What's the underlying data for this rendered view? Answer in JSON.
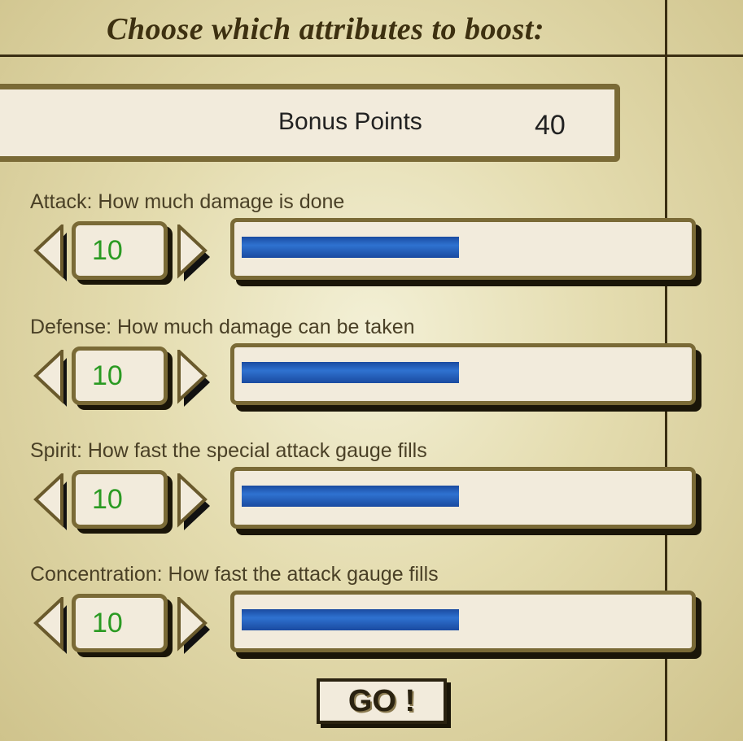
{
  "title": "Choose which attributes to boost:",
  "bonus": {
    "label": "Bonus Points",
    "value": "40"
  },
  "attributes": [
    {
      "description": "Attack: How much damage is done",
      "value": "10",
      "fill_fraction": 0.49
    },
    {
      "description": "Defense: How much damage can be taken",
      "value": "10",
      "fill_fraction": 0.49
    },
    {
      "description": "Spirit: How fast the special attack gauge fills",
      "value": "10",
      "fill_fraction": 0.49
    },
    {
      "description": "Concentration: How fast the attack gauge fills",
      "value": "10",
      "fill_fraction": 0.49
    }
  ],
  "go_button": {
    "label": "GO !"
  },
  "colors": {
    "frame": "#7a6a36",
    "panel": "#f2ebdc",
    "value_text": "#2a9a22",
    "bar": "#1e58b8"
  }
}
